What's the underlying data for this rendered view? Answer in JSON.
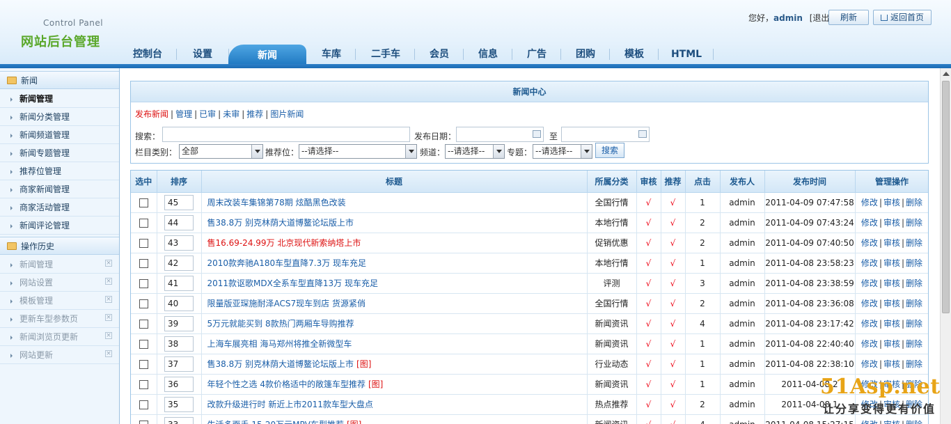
{
  "header": {
    "logo_sub": "Control Panel",
    "logo_main": "网站后台管理",
    "greeting": "您好，",
    "username": "admin",
    "logout": "[退出]",
    "refresh_label": "刷新",
    "home_label": "返回首页"
  },
  "nav": {
    "items": [
      {
        "label": "控制台"
      },
      {
        "label": "设置"
      },
      {
        "label": "新闻"
      },
      {
        "label": "车库"
      },
      {
        "label": "二手车"
      },
      {
        "label": "会员"
      },
      {
        "label": "信息"
      },
      {
        "label": "广告"
      },
      {
        "label": "团购"
      },
      {
        "label": "模板"
      },
      {
        "label": "HTML"
      }
    ],
    "active": "新闻"
  },
  "sidebar": {
    "section1": "新闻",
    "items": [
      {
        "label": "新闻管理"
      },
      {
        "label": "新闻分类管理"
      },
      {
        "label": "新闻频道管理"
      },
      {
        "label": "新闻专题管理"
      },
      {
        "label": "推荐位管理"
      },
      {
        "label": "商家新闻管理"
      },
      {
        "label": "商家活动管理"
      },
      {
        "label": "新闻评论管理"
      }
    ],
    "section2": "操作历史",
    "history": [
      {
        "label": "新闻管理"
      },
      {
        "label": "网站设置"
      },
      {
        "label": "模板管理"
      },
      {
        "label": "更新车型参数页"
      },
      {
        "label": "新闻浏览页更新"
      },
      {
        "label": "网站更新"
      }
    ]
  },
  "search": {
    "title": "新闻中心",
    "links": {
      "publish": "发布新闻",
      "manage": "管理",
      "approved": "已审",
      "unapproved": "未审",
      "recommend": "推荐",
      "image_news": "图片新闻"
    },
    "keyword_label": "搜索：",
    "date_label": "发布日期：",
    "to_label": "至",
    "category_label": "栏目类别：",
    "category_value": "全部",
    "recommend_label": "推荐位：",
    "recommend_value": "--请选择--",
    "channel_label": "频道：",
    "channel_value": "--请选择--",
    "topic_label": "专题：",
    "topic_value": "--请选择--",
    "search_button": "搜索"
  },
  "table": {
    "headers": {
      "select": "选中",
      "order": "排序",
      "title": "标题",
      "category": "所属分类",
      "audit": "审核",
      "recommend": "推荐",
      "clicks": "点击",
      "publisher": "发布人",
      "time": "发布时间",
      "ops": "管理操作"
    },
    "check_mark": "√",
    "ops": {
      "edit": "修改",
      "audit": "审核",
      "delete": "删除"
    },
    "image_tag": "[图]",
    "rows": [
      {
        "order": "45",
        "title": "周末改装车集锦第78期 炫酷黑色改装",
        "category": "全国行情",
        "clicks": "1",
        "publisher": "admin",
        "time": "2011-04-09 07:47:58"
      },
      {
        "order": "44",
        "title": "售38.8万 别克林荫大道博鳌论坛版上市",
        "category": "本地行情",
        "clicks": "2",
        "publisher": "admin",
        "time": "2011-04-09 07:43:24"
      },
      {
        "order": "43",
        "title": "售16.69-24.99万 北京现代新索纳塔上市",
        "category": "促销优惠",
        "clicks": "2",
        "publisher": "admin",
        "time": "2011-04-09 07:40:50"
      },
      {
        "order": "42",
        "title": "2010款奔驰A180车型直降7.3万 现车充足",
        "category": "本地行情",
        "clicks": "1",
        "publisher": "admin",
        "time": "2011-04-08 23:58:23"
      },
      {
        "order": "41",
        "title": "2011款讴歌MDX全系车型直降13万 现车充足",
        "category": "评测",
        "clicks": "3",
        "publisher": "admin",
        "time": "2011-04-08 23:38:59"
      },
      {
        "order": "40",
        "title": "限量版亚琛施耐泽ACS7现车到店 货源紧俏",
        "category": "全国行情",
        "clicks": "2",
        "publisher": "admin",
        "time": "2011-04-08 23:36:08"
      },
      {
        "order": "39",
        "title": "5万元就能买到 8款热门两厢车导购推荐",
        "category": "新闻资讯",
        "clicks": "4",
        "publisher": "admin",
        "time": "2011-04-08 23:17:42"
      },
      {
        "order": "38",
        "title": "上海车展亮相 海马郑州将推全新微型车",
        "category": "新闻资讯",
        "clicks": "1",
        "publisher": "admin",
        "time": "2011-04-08 22:40:40"
      },
      {
        "order": "37",
        "title": "售38.8万 别克林荫大道博鳌论坛版上市",
        "category": "行业动态",
        "clicks": "1",
        "publisher": "admin",
        "time": "2011-04-08 22:38:10"
      },
      {
        "order": "36",
        "title": "年轻个性之选 4款价格适中的敞篷车型推荐",
        "category": "新闻资讯",
        "clicks": "1",
        "publisher": "admin",
        "time": "2011-04-08 2"
      },
      {
        "order": "35",
        "title": "改款升级进行时 新近上市2011款车型大盘点",
        "category": "热点推荐",
        "clicks": "2",
        "publisher": "admin",
        "time": "2011-04-08 1"
      },
      {
        "order": "33",
        "title": "生活多面手 15-20万元MPV车型推荐",
        "category": "新闻资讯",
        "clicks": "4",
        "publisher": "admin",
        "time": "2011-04-08 15:27:15"
      }
    ]
  },
  "watermark": {
    "big": "51Asp.net",
    "small": "让分享变得更有价值"
  }
}
